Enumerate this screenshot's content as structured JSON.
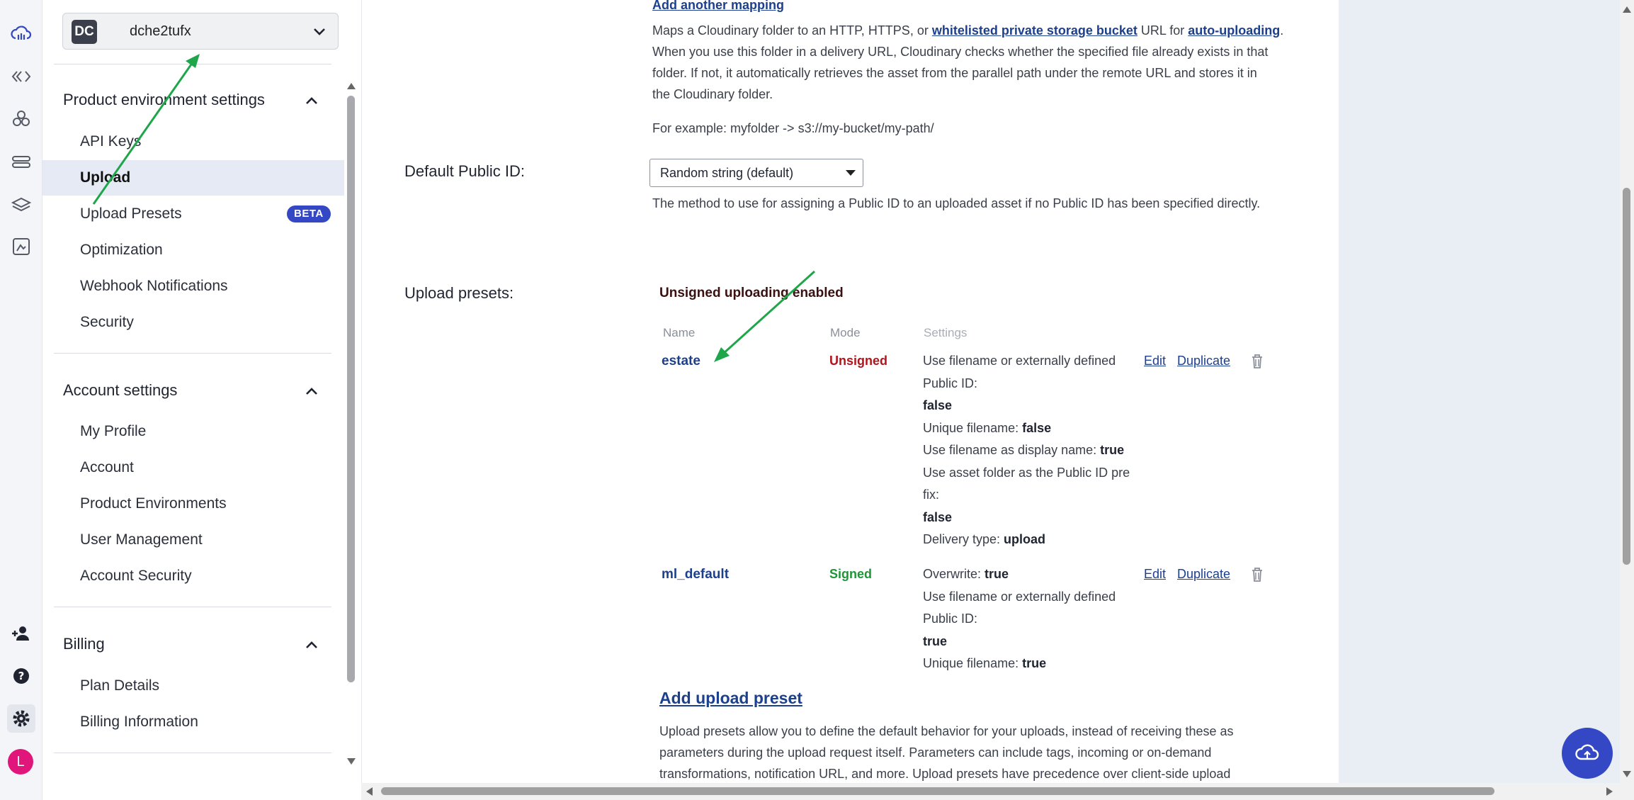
{
  "environment": {
    "badge": "DC",
    "name": "dche2tufx"
  },
  "sidebar": {
    "product_settings": {
      "title": "Product environment settings",
      "items": [
        {
          "label": "API Keys"
        },
        {
          "label": "Upload",
          "active": true
        },
        {
          "label": "Upload Presets",
          "badge": "BETA"
        },
        {
          "label": "Optimization"
        },
        {
          "label": "Webhook Notifications"
        },
        {
          "label": "Security"
        }
      ]
    },
    "account_settings": {
      "title": "Account settings",
      "items": [
        {
          "label": "My Profile"
        },
        {
          "label": "Account"
        },
        {
          "label": "Product Environments"
        },
        {
          "label": "User Management"
        },
        {
          "label": "Account Security"
        }
      ]
    },
    "billing": {
      "title": "Billing",
      "items": [
        {
          "label": "Plan Details"
        },
        {
          "label": "Billing Information"
        }
      ]
    }
  },
  "rail_icons": [
    "cloudinary-logo-icon",
    "code-icon",
    "assets-icon",
    "pipeline-icon",
    "layers-icon",
    "media-flow-icon",
    "invite-user-icon",
    "help-icon",
    "settings-icon"
  ],
  "avatar_letter": "L",
  "main": {
    "add_mapping_link": "Add another mapping",
    "mapping_desc": {
      "p1": "Maps a Cloudinary folder to an HTTP, HTTPS, or ",
      "link1": "whitelisted private storage bucket",
      "p2": " URL for ",
      "link2": "auto-uploading",
      "p3": ".",
      "line2": "When you use this folder in a delivery URL, Cloudinary checks whether the specified file already exists in that",
      "line3": "folder. If not, it automatically retrieves the asset from the parallel path under the remote URL and stores it in",
      "line4": "the Cloudinary folder."
    },
    "example": "For example: myfolder -> s3://my-bucket/my-path/",
    "public_id": {
      "label": "Default Public ID:",
      "value": "Random string (default)",
      "help": "The method to use for assigning a Public ID to an uploaded asset if no Public ID has been specified directly."
    },
    "presets": {
      "label": "Upload presets:",
      "status": "Unsigned uploading enabled",
      "headers": {
        "name": "Name",
        "mode": "Mode",
        "settings": "Settings"
      },
      "rows": [
        {
          "name": "estate",
          "mode": "Unsigned",
          "mode_color": "#b3141b",
          "settings": [
            [
              "Use filename or externally defined",
              ""
            ],
            [
              "Public ID:",
              ""
            ],
            [
              "",
              "false"
            ],
            [
              "Unique filename: ",
              "false"
            ],
            [
              "Use filename as display name: ",
              "true"
            ],
            [
              "Use asset folder as the Public ID pre",
              ""
            ],
            [
              "fix:",
              ""
            ],
            [
              "",
              "false"
            ],
            [
              "Delivery type: ",
              "upload"
            ]
          ],
          "edit": "Edit",
          "duplicate": "Duplicate"
        },
        {
          "name": "ml_default",
          "mode": "Signed",
          "mode_color": "#1e9637",
          "settings": [
            [
              "Overwrite: ",
              "true"
            ],
            [
              "Use filename or externally defined",
              ""
            ],
            [
              "Public ID:",
              ""
            ],
            [
              "",
              "true"
            ],
            [
              "Unique filename: ",
              "true"
            ]
          ],
          "edit": "Edit",
          "duplicate": "Duplicate"
        }
      ],
      "add_link": "Add upload preset",
      "desc_lines": [
        "Upload presets allow you to define the default behavior for your uploads, instead of receiving these as",
        "parameters during the upload request itself. Parameters can include tags, incoming or on-demand",
        "transformations, notification URL, and more. Upload presets have precedence over client-side upload"
      ]
    }
  },
  "colors": {
    "accent": "#3448c5",
    "link": "#1c3f8e",
    "arrow": "#1fa64a",
    "unsigned": "#b3141b",
    "signed": "#1e9637"
  }
}
